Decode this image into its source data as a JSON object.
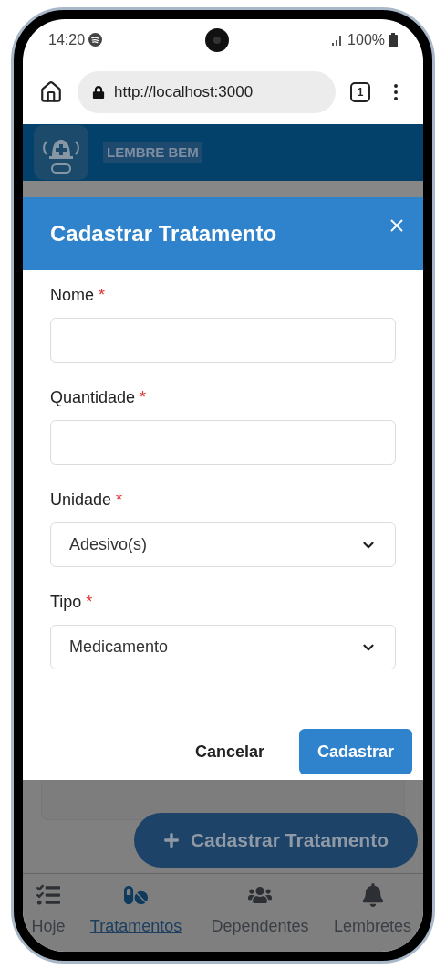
{
  "status_bar": {
    "time": "14:20",
    "battery": "100%"
  },
  "browser": {
    "url": "http://localhost:3000",
    "tab_count": "1"
  },
  "app_header": {
    "title": "LEMBRE BEM"
  },
  "dialog": {
    "title": "Cadastrar Tratamento",
    "fields": [
      {
        "kind": "text",
        "label": "Nome",
        "marker": "*"
      },
      {
        "kind": "text",
        "label": "Quantidade",
        "marker": "*"
      },
      {
        "kind": "select",
        "label": "Unidade",
        "marker": "*",
        "value": "Adesivo(s)"
      },
      {
        "kind": "select",
        "label": "Tipo",
        "marker": "*",
        "value": "Medicamento"
      }
    ],
    "buttons": [
      {
        "kind": "secondary",
        "label": "Cancelar"
      },
      {
        "kind": "primary",
        "label": "Cadastrar"
      }
    ]
  },
  "fab": {
    "label": "Cadastrar Tratamento"
  },
  "bottom_nav": [
    {
      "kind": "today",
      "label": "Hoje",
      "selected": false
    },
    {
      "kind": "treatments",
      "label": "Tratamentos",
      "selected": true
    },
    {
      "kind": "dependents",
      "label": "Dependentes",
      "selected": false
    },
    {
      "kind": "reminders",
      "label": "Lembretes",
      "selected": false
    }
  ]
}
